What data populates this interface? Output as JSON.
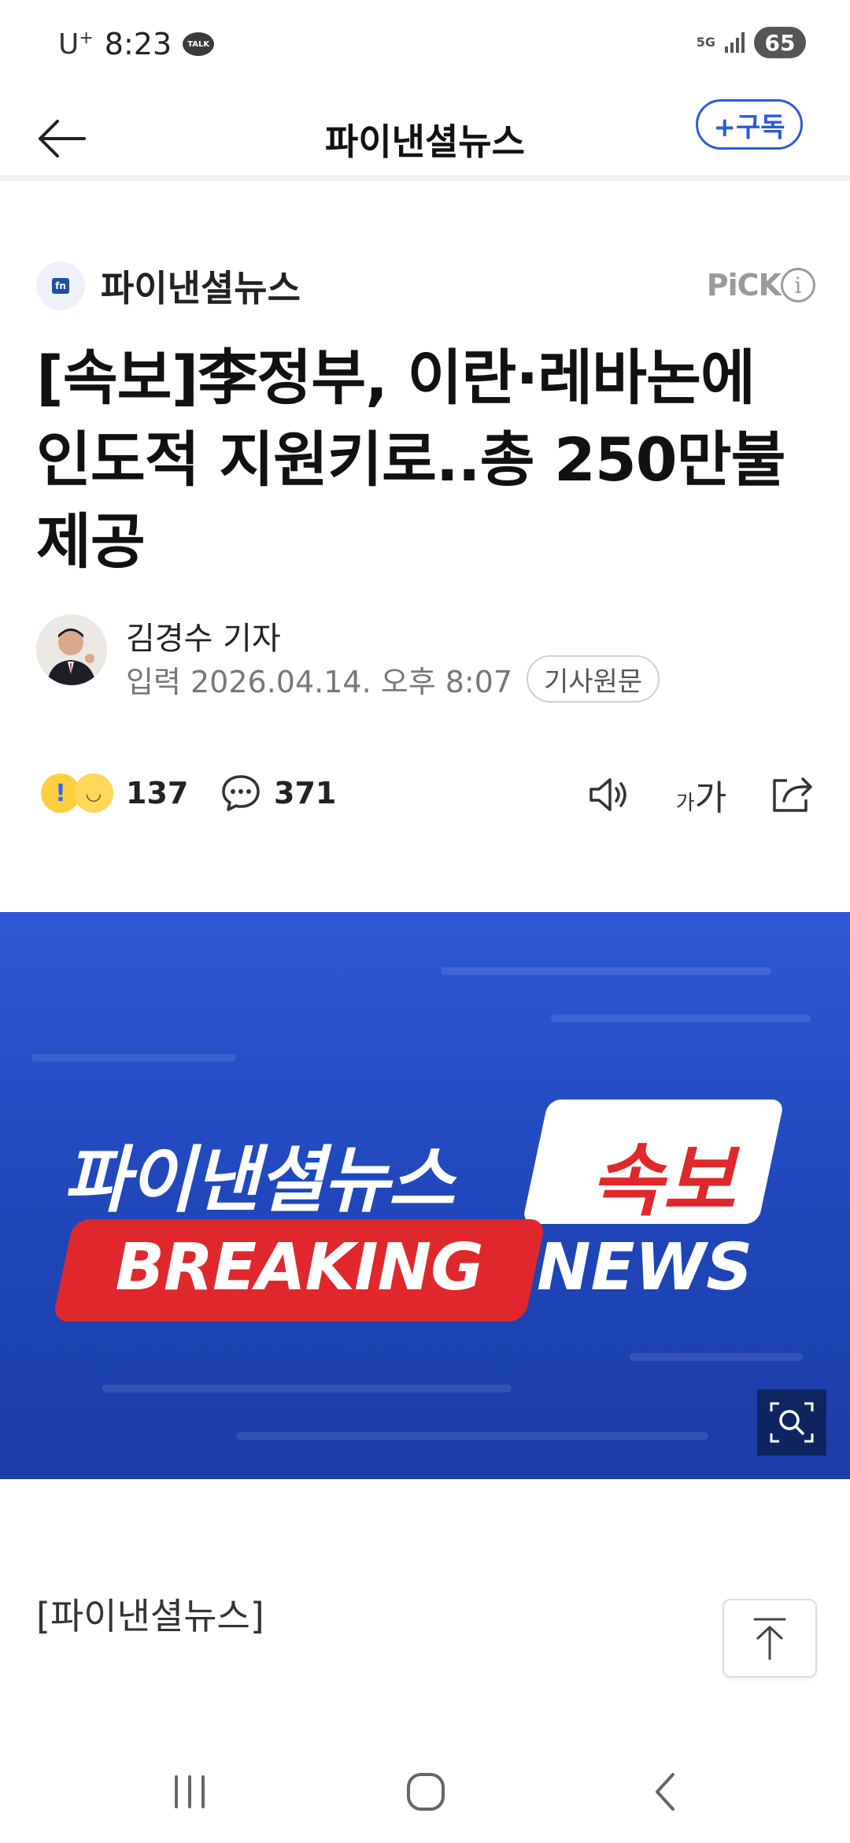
{
  "status_bar": {
    "carrier": "U",
    "carrier_sup": "+",
    "time": "8:23",
    "talk_badge": "TALK",
    "network": "5G",
    "battery": "65"
  },
  "app_bar": {
    "title": "파이낸셜뉴스",
    "subscribe_label": "+구독"
  },
  "article": {
    "press_name": "파이낸셜뉴스",
    "press_logo_text": "fn",
    "pick_label": "PiCK",
    "info_label": "i",
    "headline": "[속보]李정부, 이란·레바논에 인도적 지원키로..총 250만불 제공",
    "reporter": "김경수 기자",
    "input_date": "입력 2026.04.14. 오후 8:07",
    "original_button": "기사원문",
    "reactions_count": "137",
    "comments_count": "371",
    "font_size_label_small": "가",
    "font_size_label_big": "가",
    "body_source": "[파이낸셜뉴스]"
  },
  "banner": {
    "brand": "파이낸셜뉴스",
    "sokbo": "속보",
    "breaking": "BREAKING",
    "news": "NEWS"
  },
  "colors": {
    "accent": "#2b5bd7",
    "banner_blue": "#2d59d6",
    "banner_red": "#e0282c"
  },
  "icons": [
    "back-arrow-icon",
    "info-icon",
    "reaction-emoji-icon",
    "comment-bubble-icon",
    "speaker-icon",
    "font-size-icon",
    "share-icon",
    "zoom-icon",
    "scroll-top-icon",
    "recent-apps-icon",
    "home-icon",
    "nav-back-icon"
  ]
}
